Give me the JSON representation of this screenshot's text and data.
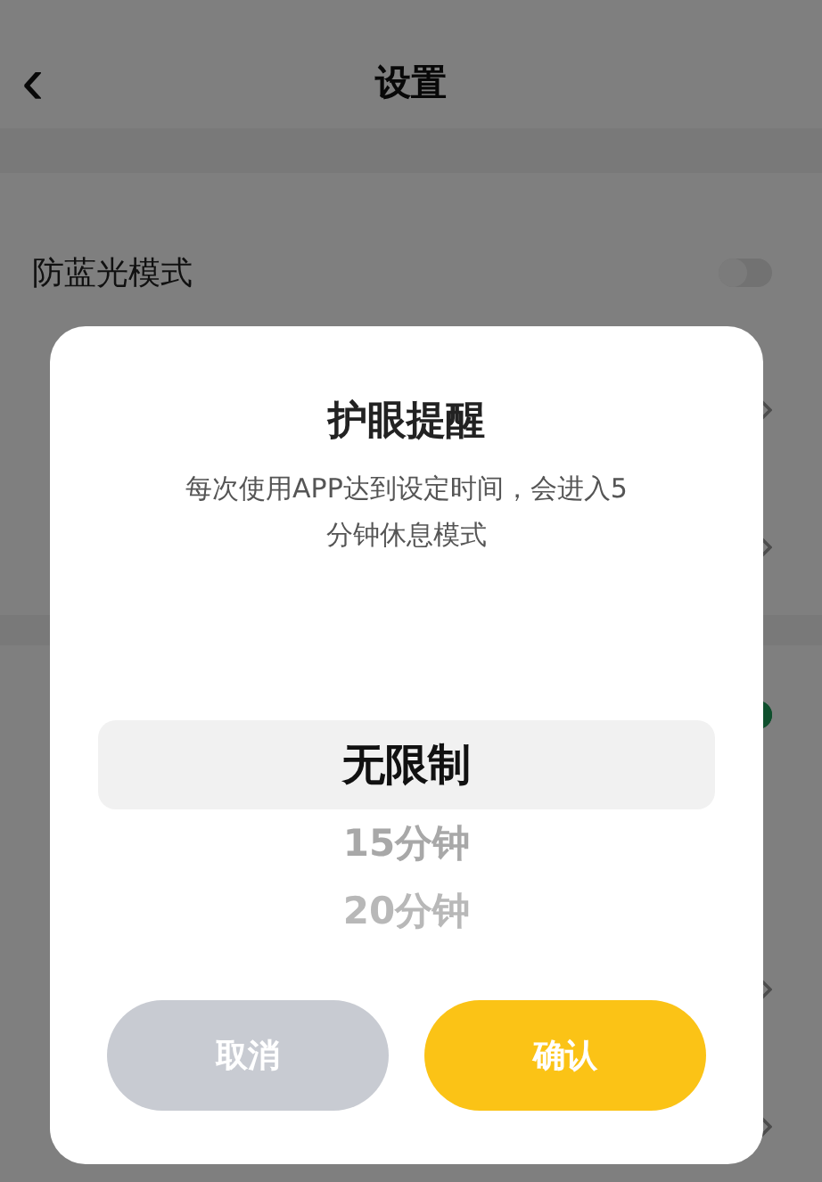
{
  "header": {
    "back": "‹",
    "title": "设置"
  },
  "groups": [
    {
      "rows": [
        {
          "kind": "toggle",
          "label": "防蓝光模式",
          "on": false
        },
        {
          "kind": "chevron"
        },
        {
          "kind": "chevron"
        }
      ]
    },
    {
      "rows": [
        {
          "kind": "toggle",
          "on": true
        },
        {
          "kind": "plain"
        },
        {
          "kind": "chevron"
        },
        {
          "kind": "chevron"
        }
      ]
    }
  ],
  "dialog": {
    "title": "护眼提醒",
    "description": "每次使用APP达到设定时间，会进入5分钟休息模式",
    "options": [
      {
        "label": "无限制",
        "selected": true
      },
      {
        "label": "15分钟",
        "selected": false
      },
      {
        "label": "20分钟",
        "selected": false
      }
    ],
    "buttons": [
      {
        "kind": "cancel",
        "label": "取消"
      },
      {
        "kind": "confirm",
        "label": "确认"
      }
    ]
  }
}
